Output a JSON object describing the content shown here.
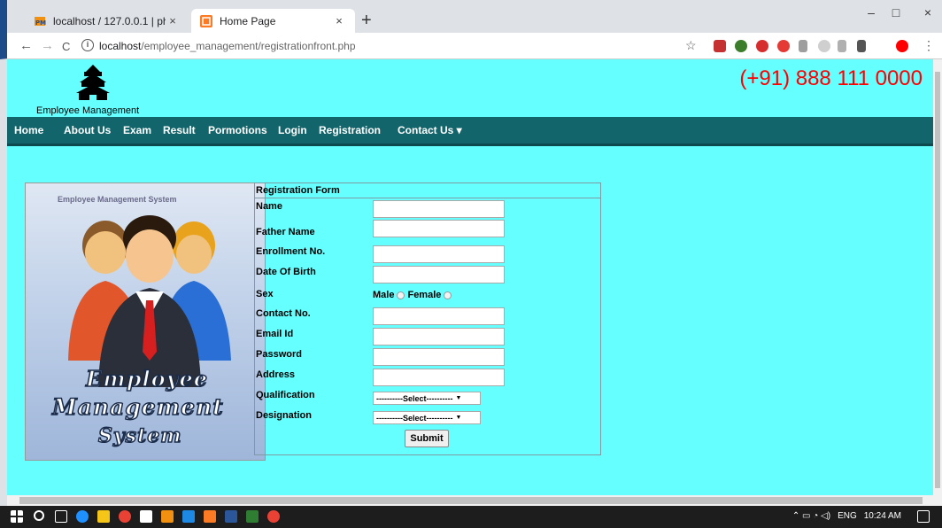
{
  "browser": {
    "tabs": [
      {
        "title": "localhost / 127.0.0.1 | phpMyAdm",
        "close": "×"
      },
      {
        "title": "Home Page",
        "close": "×"
      }
    ],
    "new_tab": "+",
    "window_controls": {
      "minimize": "–",
      "maximize": "□",
      "close": "×"
    },
    "nav": {
      "back": "←",
      "forward": "→",
      "reload": "C",
      "info": "i"
    },
    "url_host": "localhost",
    "url_path": "/employee_management/registrationfront.php",
    "star": "☆",
    "menu": "⋮"
  },
  "site": {
    "brand": "Employee Management",
    "phone": "(+91) 888 111 0000",
    "menu": [
      "Home",
      "About Us",
      "Exam",
      "Result",
      "Pormotions",
      "Login",
      "Registration",
      "Contact Us  ▾"
    ]
  },
  "hero": {
    "caption": "Employee Management System",
    "words": [
      "Employee",
      "Management",
      "System"
    ]
  },
  "form": {
    "title": "Registration Form",
    "labels": {
      "name": "Name",
      "father_name": "Father Name",
      "enrollment": "Enrollment No.",
      "dob": "Date Of Birth",
      "sex": "Sex",
      "contact": "Contact No.",
      "email": "Email Id",
      "password": "Password",
      "address": "Address",
      "qualification": "Qualification",
      "designation": "Designation"
    },
    "sex_options": {
      "male": "Male",
      "female": "Female"
    },
    "qualification_value": "----------Select----------",
    "designation_value": "----------Select----------",
    "submit": "Submit"
  },
  "taskbar": {
    "lang": "ENG",
    "time": "10:24 AM"
  },
  "colors": {
    "page_bg": "#66ffff",
    "menubar": "#13656c",
    "phone": "#ff0000"
  }
}
